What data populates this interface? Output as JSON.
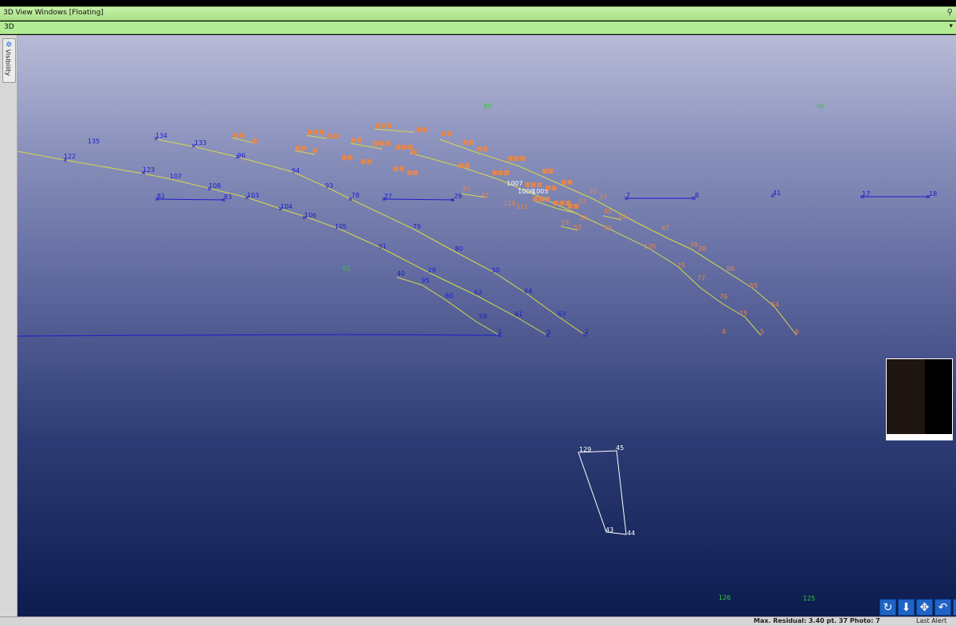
{
  "window": {
    "title": "3D View Windows [Floating]",
    "pin": "⚲"
  },
  "view_selector": {
    "value": "3D",
    "arrow": "▾"
  },
  "side_tab": {
    "label": "Visibility",
    "icon": "gear-icon"
  },
  "colors": {
    "blue": "#1a1ccf",
    "orange": "#e8874a",
    "yellow": "#d8d84a",
    "white": "#ffffff",
    "green": "#33cc33"
  },
  "status": {
    "residual": "Max. Residual: 3.40 pt. 37 Photo: 7",
    "alert": "Last Alert"
  },
  "nav_buttons": [
    {
      "name": "orbit-icon",
      "glyph": "↻"
    },
    {
      "name": "move-down-icon",
      "glyph": "⬇"
    },
    {
      "name": "pan-icon",
      "glyph": "✥"
    },
    {
      "name": "undo-view-icon",
      "glyph": "↶"
    },
    {
      "name": "zoom-extents-icon",
      "glyph": "⤢"
    }
  ],
  "points": {
    "blue": [
      "135",
      "122",
      "134",
      "133",
      "96",
      "123",
      "107",
      "108",
      "82",
      "83",
      "103",
      "94",
      "93",
      "104",
      "106",
      "78",
      "105",
      "27",
      "28",
      "79",
      "91",
      "80",
      "40",
      "29",
      "95",
      "30",
      "60",
      "62",
      "64",
      "59",
      "61",
      "63",
      "1",
      "3",
      "2",
      "7",
      "8",
      "41",
      "17",
      "18"
    ],
    "green": [
      "85",
      "46",
      "92",
      "126",
      "125"
    ],
    "white": [
      "1007",
      "1006",
      "1005",
      "129",
      "45",
      "43",
      "44"
    ],
    "orange": [
      "120",
      "25",
      "77",
      "76",
      "75",
      "4",
      "5",
      "6",
      "86",
      "55",
      "54",
      "39",
      "38",
      "47",
      "48",
      "50",
      "49",
      "36",
      "37",
      "40",
      "41",
      "110",
      "111",
      "53",
      "52",
      "56",
      "57"
    ]
  }
}
